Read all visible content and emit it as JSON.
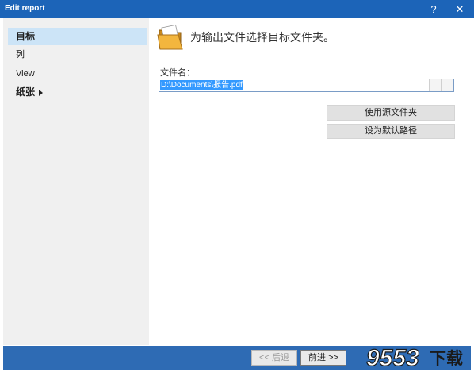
{
  "window": {
    "title": "Edit report",
    "help_label": "?",
    "close_label": "✕"
  },
  "sidebar": {
    "items": [
      {
        "label": "目标",
        "active": true
      },
      {
        "label": "列"
      },
      {
        "label": "View"
      },
      {
        "label": "纸张",
        "has_submenu": true
      }
    ]
  },
  "main": {
    "heading": "为输出文件选择目标文件夹。",
    "file_label": "文件名：",
    "file_value": "D:\\Documents\\报告.pdf",
    "dot_button": ".",
    "browse_button": "...",
    "use_source_button": "使用源文件夹",
    "set_default_button": "设为默认路径"
  },
  "footer": {
    "back_button": "<< 后退",
    "next_button": "前进 >>"
  },
  "watermark": {
    "text": "9553下载"
  },
  "colors": {
    "titlebar": "#1c64b8",
    "footer": "#2e6bb4",
    "selection": "#cce4f7",
    "text_highlight": "#3399ff"
  }
}
